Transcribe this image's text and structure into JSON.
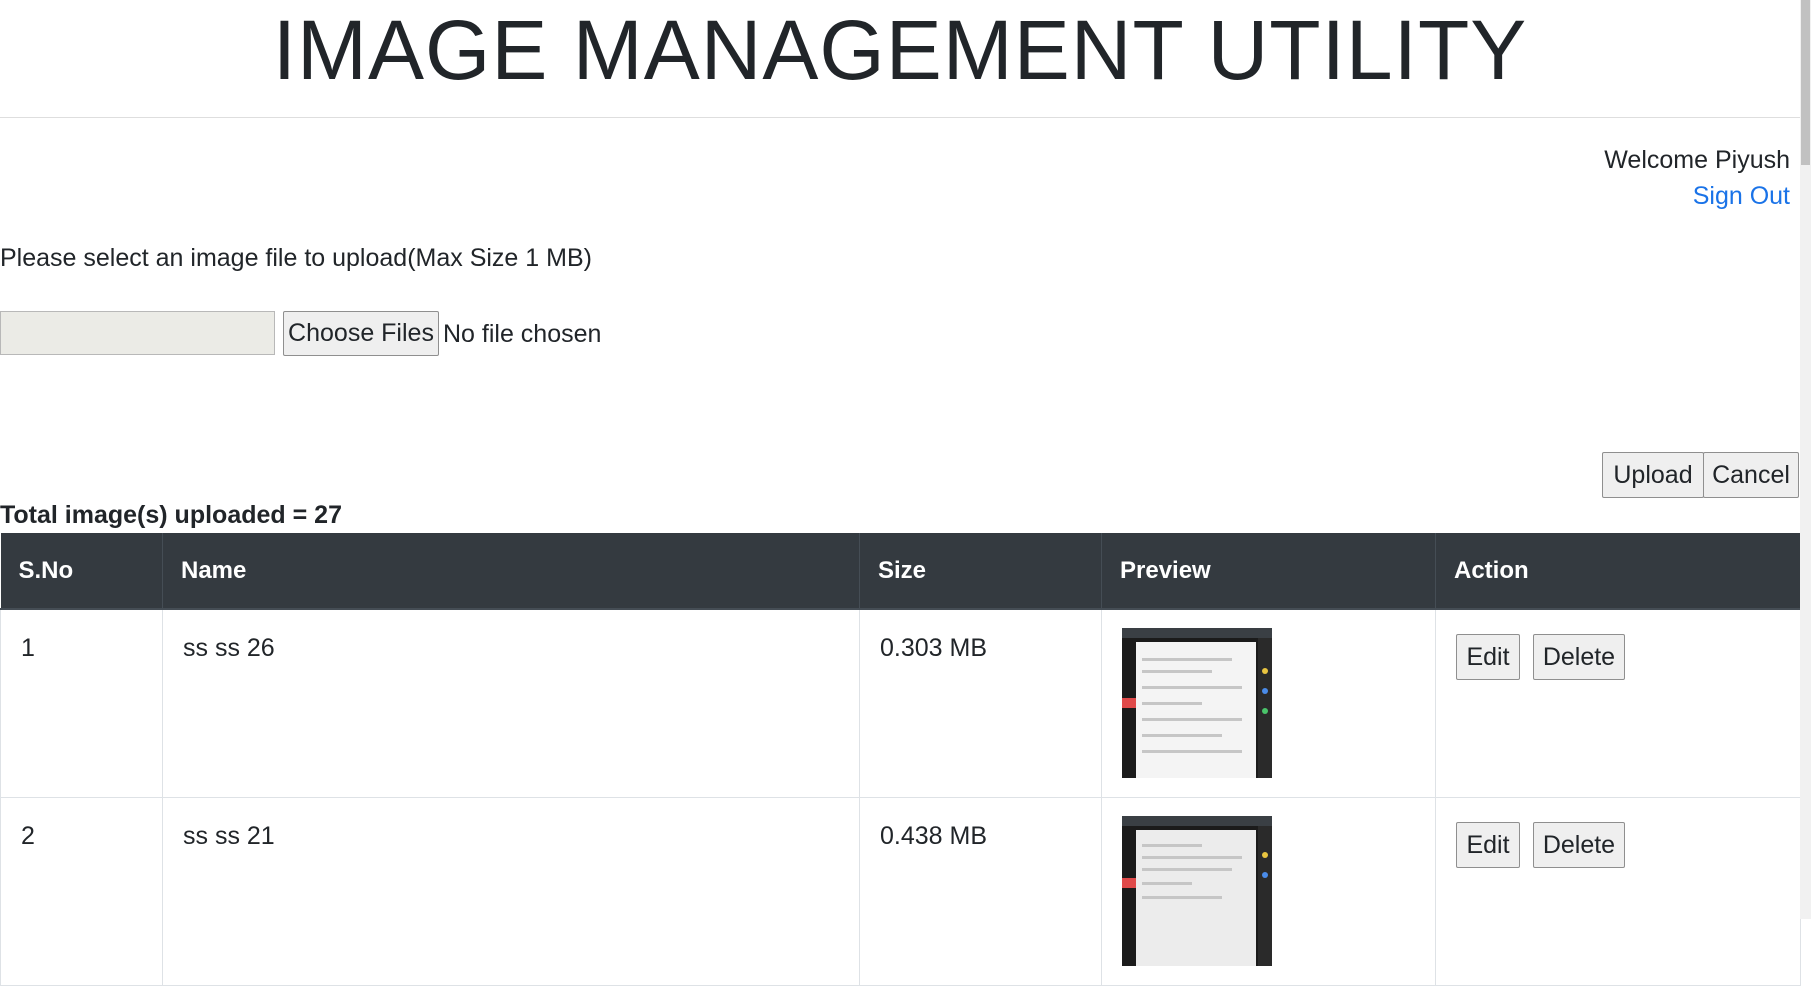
{
  "header": {
    "title": "IMAGE MANAGEMENT UTILITY"
  },
  "user": {
    "welcome": "Welcome Piyush",
    "sign_out": "Sign Out"
  },
  "upload": {
    "instruction": "Please select an image file to upload(Max Size 1 MB)",
    "choose_label": "Choose Files",
    "no_file_text": "No file chosen",
    "upload_label": "Upload",
    "cancel_label": "Cancel"
  },
  "summary": {
    "total_text": "Total image(s) uploaded = 27"
  },
  "table": {
    "headers": [
      "S.No",
      "Name",
      "Size",
      "Preview",
      "Action"
    ],
    "rows": [
      {
        "sno": "1",
        "name": "ss ss 26",
        "size": "0.303 MB",
        "edit": "Edit",
        "delete": "Delete"
      },
      {
        "sno": "2",
        "name": "ss ss 21",
        "size": "0.438 MB",
        "edit": "Edit",
        "delete": "Delete"
      }
    ]
  },
  "colors": {
    "header_bg": "#343a40",
    "link": "#1a73e8",
    "button_bg": "#efefef"
  }
}
